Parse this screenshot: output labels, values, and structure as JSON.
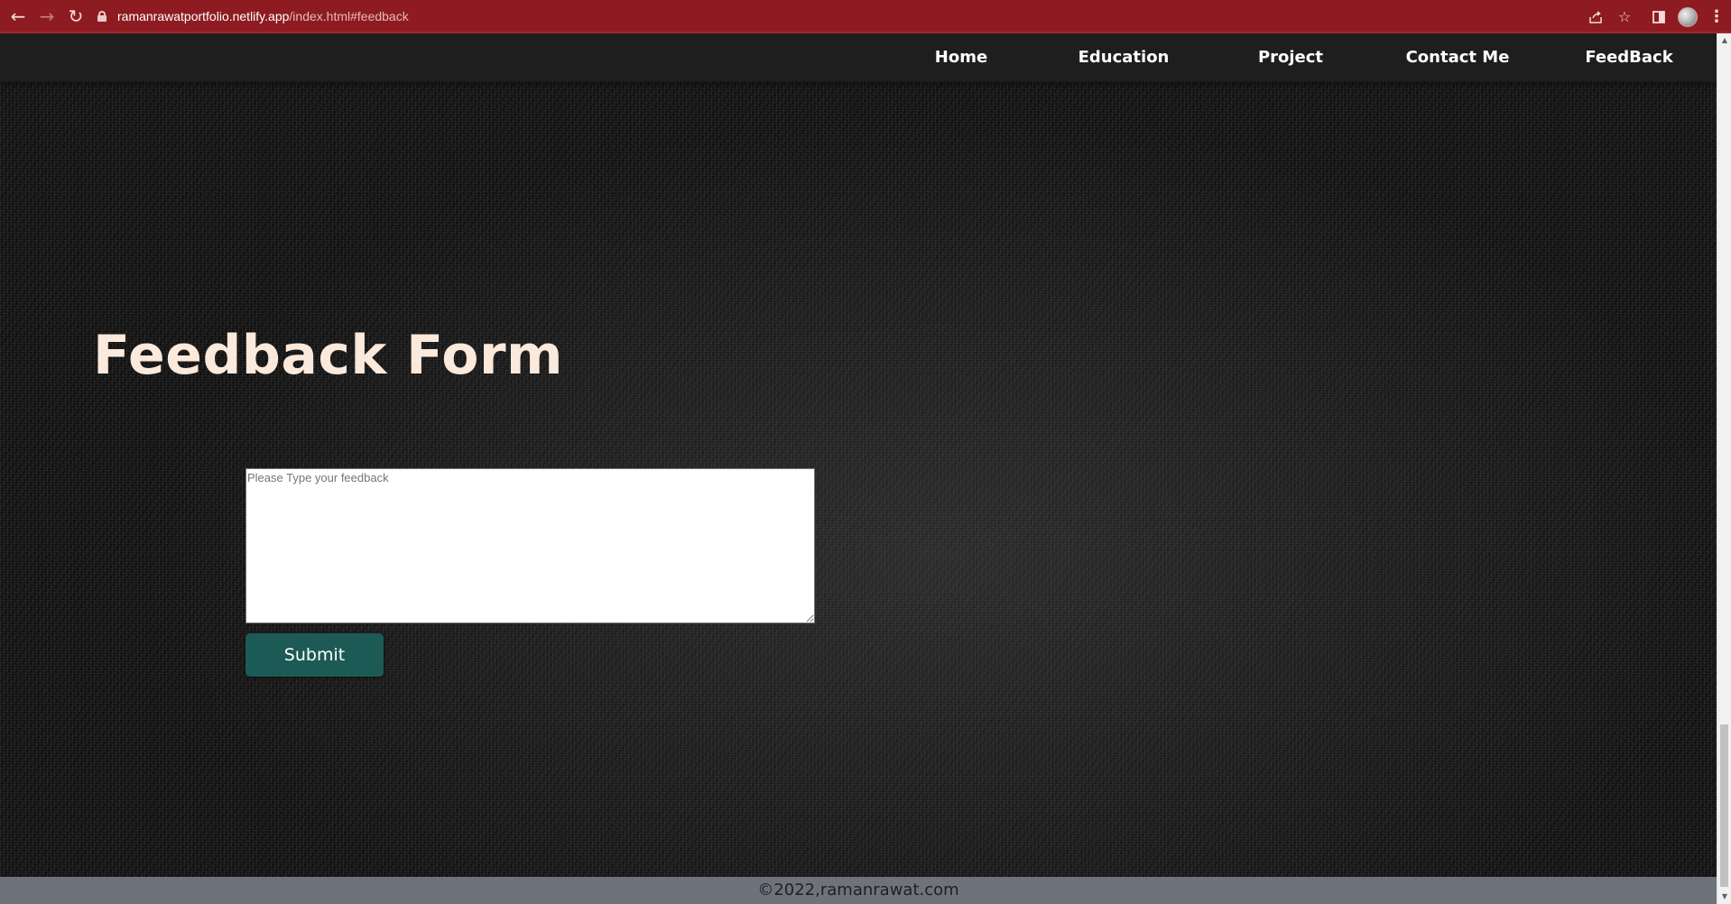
{
  "browser": {
    "url_host": "ramanrawatportfolio.netlify.app",
    "url_path": "/index.html#feedback",
    "icons": {
      "back": "arrow-left-icon",
      "forward": "arrow-right-icon",
      "reload": "reload-icon",
      "lock": "lock-icon",
      "share": "share-icon",
      "bookmark": "star-icon",
      "side_panel": "side-panel-icon",
      "profile": "profile-avatar",
      "menu": "kebab-menu-icon"
    },
    "colors": {
      "chrome_bg": "#8e1b21"
    }
  },
  "nav": {
    "items": [
      {
        "label": "Home"
      },
      {
        "label": "Education"
      },
      {
        "label": "Project"
      },
      {
        "label": "Contact Me"
      },
      {
        "label": "FeedBack"
      }
    ],
    "colors": {
      "bg": "#1e1e1e",
      "text": "#ffffff"
    }
  },
  "feedback": {
    "title": "Feedback Form",
    "textarea": {
      "placeholder": "Please Type your feedback",
      "value": ""
    },
    "submit_label": "Submit",
    "colors": {
      "title": "#fbe9db",
      "submit_bg": "#1c5a55"
    }
  },
  "footer": {
    "text": "©2022,ramanrawat.com",
    "colors": {
      "bg": "#6e737b"
    }
  }
}
